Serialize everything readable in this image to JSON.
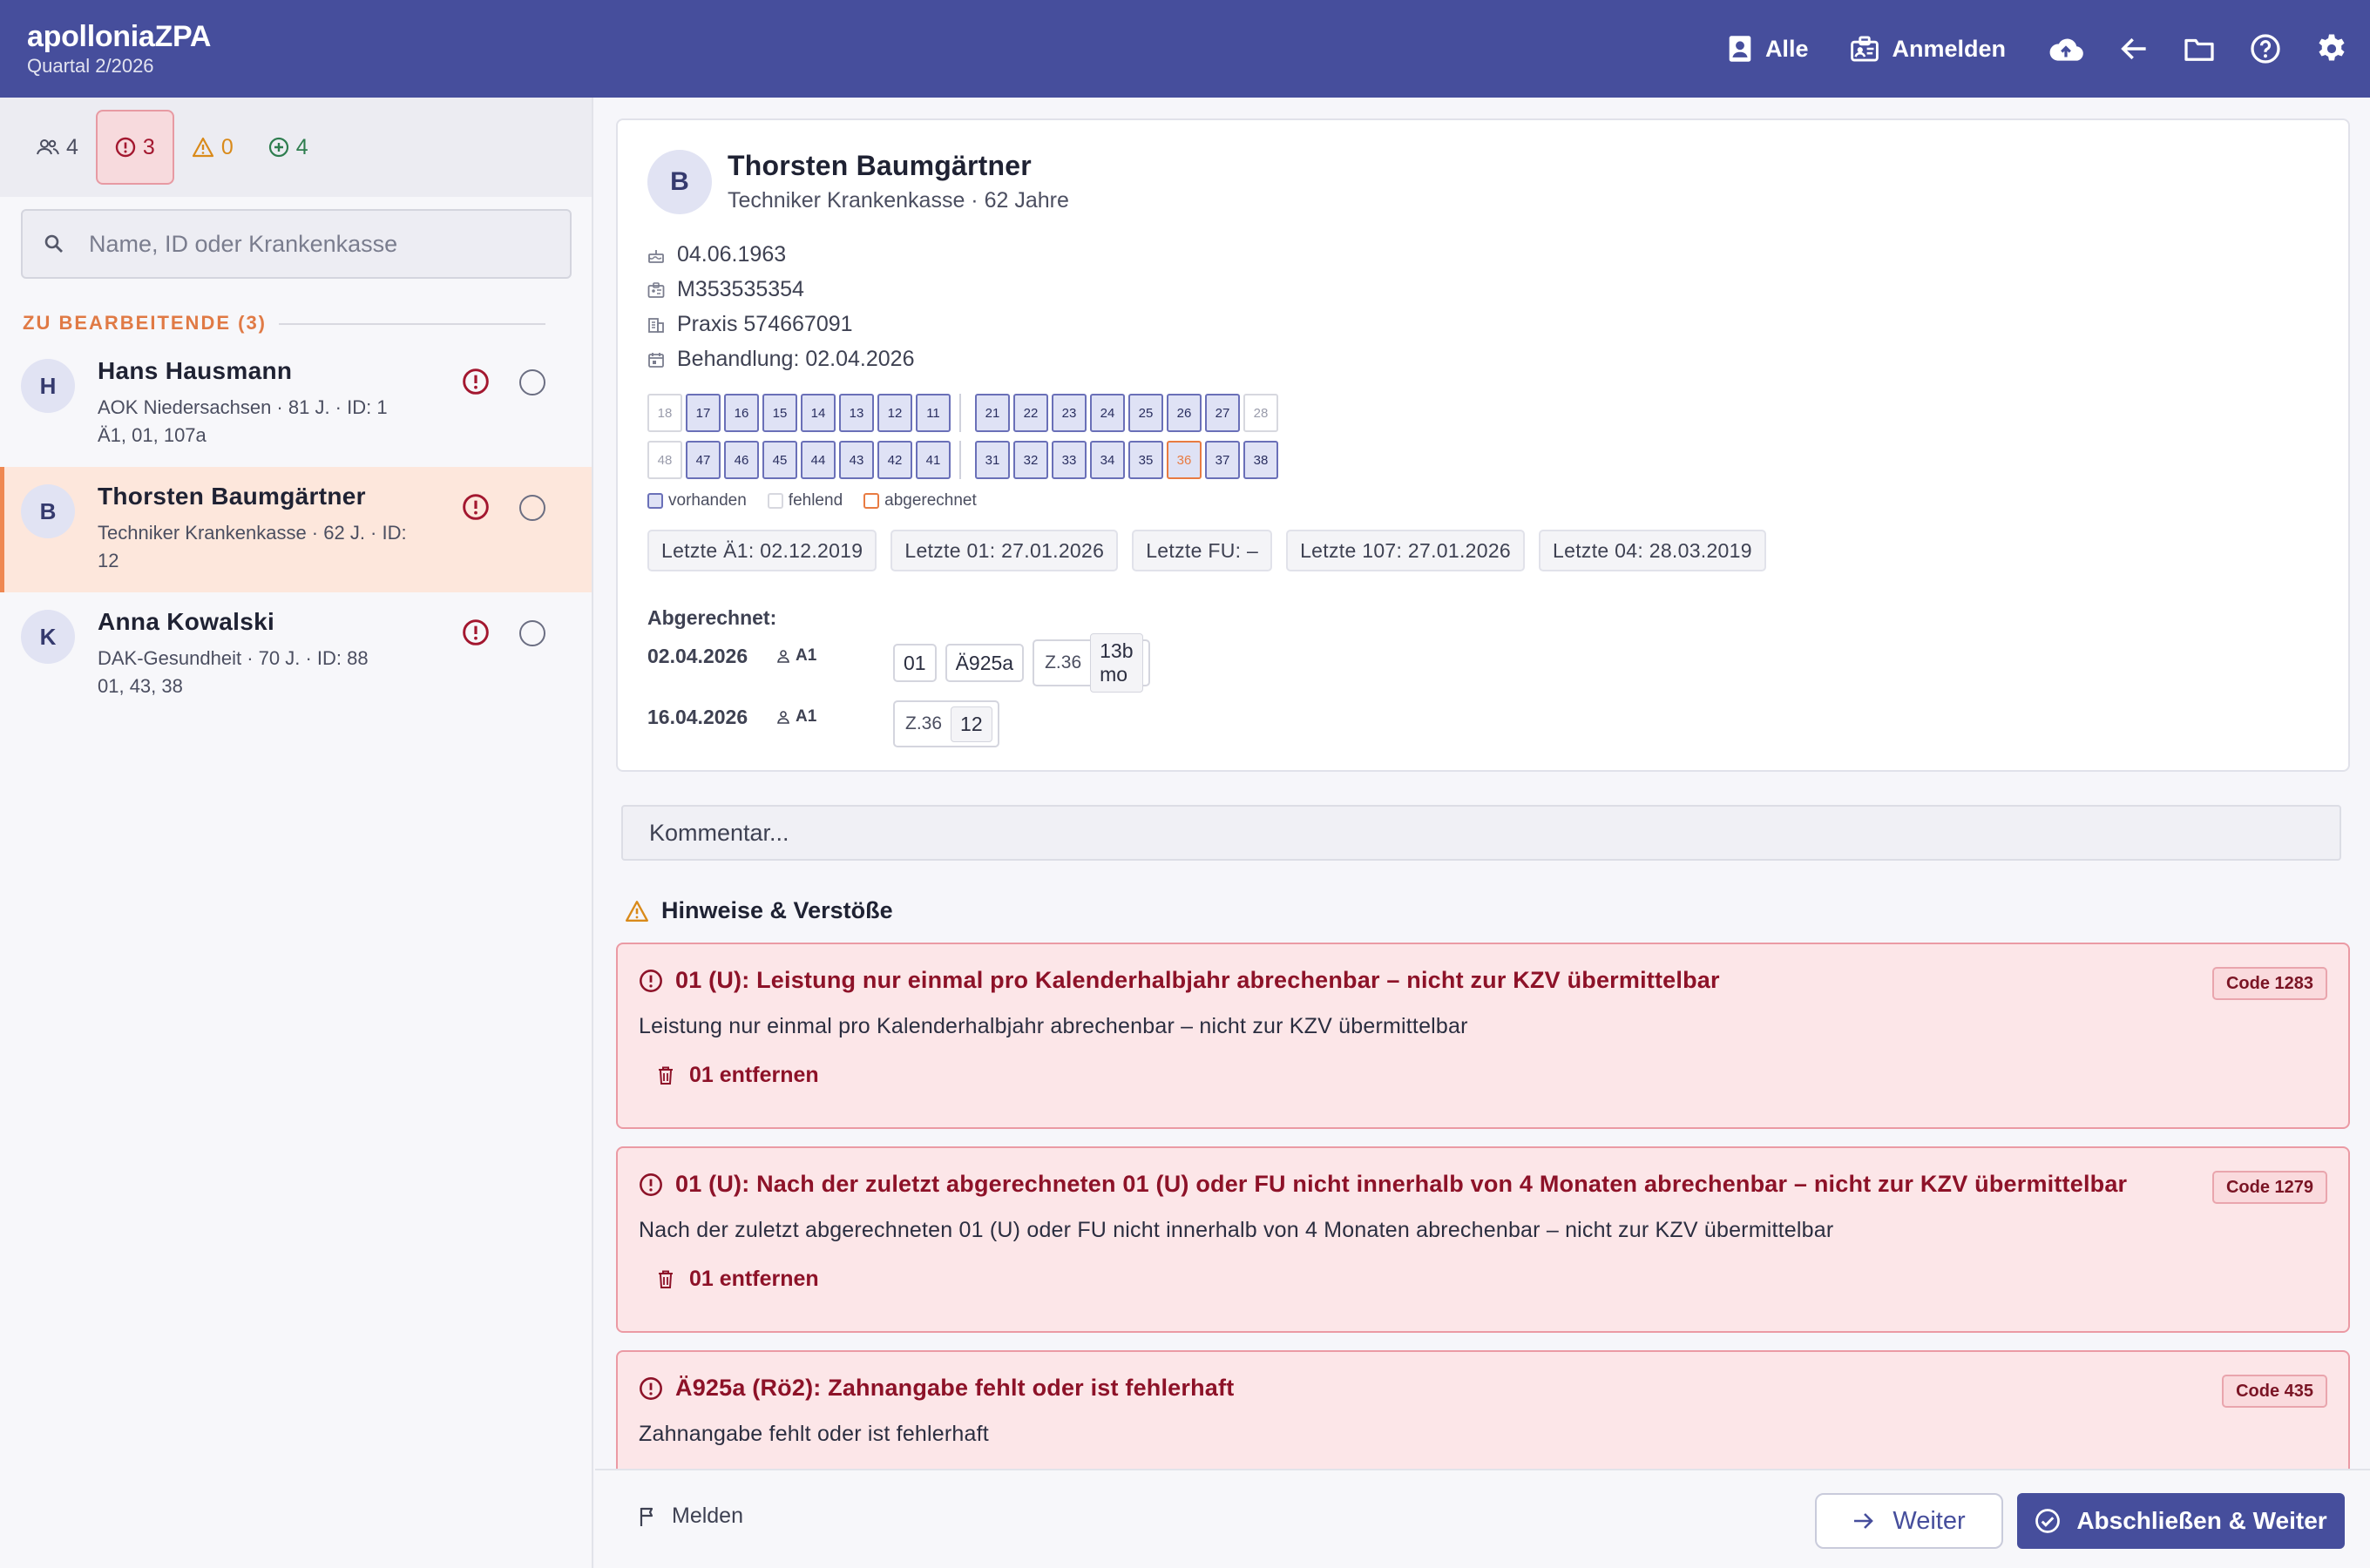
{
  "app": {
    "name": "apolloniaZPA",
    "quarter": "Quartal 2/2026"
  },
  "topbar": {
    "alle_label": "Alle",
    "anmelden_label": "Anmelden",
    "icons": [
      "cloud-upload-icon",
      "arrow-left-icon",
      "folder-icon",
      "help-icon",
      "settings-icon"
    ]
  },
  "filters": {
    "all": "4",
    "errors": "3",
    "warnings": "0",
    "ok": "4"
  },
  "search": {
    "placeholder": "Name, ID oder Krankenkasse"
  },
  "list": {
    "section_title": "ZU BEARBEITENDE (3)",
    "patients": [
      {
        "initial": "H",
        "name": "Hans Hausmann",
        "meta1": "AOK Niedersachsen · 81 J. · ID: 1",
        "meta2": "Ä1, 01, 107a"
      },
      {
        "initial": "B",
        "name": "Thorsten Baumgärtner",
        "meta1": "Techniker Krankenkasse · 62 J. · ID:",
        "meta2": "12"
      },
      {
        "initial": "K",
        "name": "Anna Kowalski",
        "meta1": "DAK-Gesundheit · 70 J. · ID: 88",
        "meta2": "01, 43, 38"
      }
    ]
  },
  "patient": {
    "initial": "B",
    "name": "Thorsten Baumgärtner",
    "subtitle": "Techniker Krankenkasse · 62 Jahre",
    "birthdate": "04.06.1963",
    "insurance_id": "M353535354",
    "practice": "Praxis 574667091",
    "treatment": "Behandlung: 02.04.2026"
  },
  "dental_chart": {
    "upper_right": [
      {
        "n": "18",
        "s": "miss"
      },
      {
        "n": "17",
        "s": "ok"
      },
      {
        "n": "16",
        "s": "ok"
      },
      {
        "n": "15",
        "s": "ok"
      },
      {
        "n": "14",
        "s": "ok"
      },
      {
        "n": "13",
        "s": "ok"
      },
      {
        "n": "12",
        "s": "ok"
      },
      {
        "n": "11",
        "s": "ok"
      }
    ],
    "upper_left": [
      {
        "n": "21",
        "s": "ok"
      },
      {
        "n": "22",
        "s": "ok"
      },
      {
        "n": "23",
        "s": "ok"
      },
      {
        "n": "24",
        "s": "ok"
      },
      {
        "n": "25",
        "s": "ok"
      },
      {
        "n": "26",
        "s": "ok"
      },
      {
        "n": "27",
        "s": "ok"
      },
      {
        "n": "28",
        "s": "miss"
      }
    ],
    "lower_right": [
      {
        "n": "48",
        "s": "miss"
      },
      {
        "n": "47",
        "s": "ok"
      },
      {
        "n": "46",
        "s": "ok"
      },
      {
        "n": "45",
        "s": "ok"
      },
      {
        "n": "44",
        "s": "ok"
      },
      {
        "n": "43",
        "s": "ok"
      },
      {
        "n": "42",
        "s": "ok"
      },
      {
        "n": "41",
        "s": "ok"
      }
    ],
    "lower_left": [
      {
        "n": "31",
        "s": "ok"
      },
      {
        "n": "32",
        "s": "ok"
      },
      {
        "n": "33",
        "s": "ok"
      },
      {
        "n": "34",
        "s": "ok"
      },
      {
        "n": "35",
        "s": "ok"
      },
      {
        "n": "36",
        "s": "bill"
      },
      {
        "n": "37",
        "s": "ok"
      },
      {
        "n": "38",
        "s": "ok"
      }
    ],
    "legend": {
      "present": "vorhanden",
      "missing": "fehlend",
      "billed": "abgerechnet"
    },
    "colors": {
      "present": "#dfe2f5",
      "billed": "#e87b42"
    }
  },
  "last_services": [
    "Letzte Ä1: 02.12.2019",
    "Letzte 01: 27.01.2026",
    "Letzte FU: –",
    "Letzte 107: 27.01.2026",
    "Letzte 04: 28.03.2019"
  ],
  "billed": {
    "title": "Abgerechnet:",
    "entries": [
      {
        "date": "02.04.2026",
        "provider": "A1",
        "codes": [
          "01",
          "Ä925a"
        ],
        "group_label": "Z.36",
        "group_value": "13b mo"
      },
      {
        "date": "16.04.2026",
        "provider": "A1",
        "group_label": "Z.36",
        "group_value": "12"
      }
    ]
  },
  "comment": {
    "placeholder": "Kommentar..."
  },
  "hints": {
    "title": "Hinweise & Verstöße",
    "issues": [
      {
        "title": "01 (U): Leistung nur einmal pro Kalenderhalbjahr abrechenbar – nicht zur KZV übermittelbar",
        "code": "Code 1283",
        "desc": "Leistung nur einmal pro Kalenderhalbjahr abrechenbar – nicht zur KZV übermittelbar",
        "action": "01 entfernen"
      },
      {
        "title": "01 (U): Nach der zuletzt abgerechneten 01 (U) oder FU nicht innerhalb von 4 Monaten abrechenbar – nicht zur KZV übermittelbar",
        "code": "Code 1279",
        "desc": "Nach der zuletzt abgerechneten 01 (U) oder FU nicht innerhalb von 4 Monaten abrechenbar – nicht zur KZV übermittelbar",
        "action": "01 entfernen"
      },
      {
        "title": "Ä925a (Rö2): Zahnangabe fehlt oder ist fehlerhaft",
        "code": "Code 435",
        "desc": "Zahnangabe fehlt oder ist fehlerhaft"
      }
    ]
  },
  "footer": {
    "melden": "Melden",
    "weiter": "Weiter",
    "abschliessen": "Abschließen & Weiter"
  },
  "colors": {
    "primary": "#464e9c",
    "error": "#8d1228",
    "warning": "#d98a1a",
    "success": "#2e7d4f",
    "accent": "#e07a45"
  }
}
